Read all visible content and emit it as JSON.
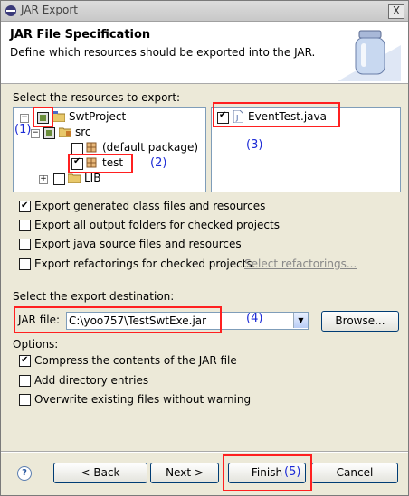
{
  "window": {
    "title": "JAR Export",
    "close_label": "X"
  },
  "header": {
    "title": "JAR File Specification",
    "subtitle": "Define which resources should be exported into the JAR."
  },
  "resources": {
    "label": "Select the resources to export:",
    "tree": {
      "project": "SwtProject",
      "src": "src",
      "default_package": "(default package)",
      "test": "test",
      "lib": "LIB"
    },
    "files": [
      {
        "name": "EventTest.java",
        "checked": true
      }
    ]
  },
  "options_top": [
    {
      "label": "Export generated class files and resources",
      "checked": true
    },
    {
      "label": "Export all output folders for checked projects",
      "checked": false
    },
    {
      "label": "Export java source files and resources",
      "checked": false
    },
    {
      "label": "Export refactorings for checked projects.",
      "checked": false,
      "link": "Select refactorings..."
    }
  ],
  "destination": {
    "label": "Select the export destination:",
    "jar_label": "JAR file:",
    "jar_value": "C:\\yoo757\\TestSwtExe.jar",
    "browse": "Browse..."
  },
  "options": {
    "label": "Options:",
    "items": [
      {
        "label": "Compress the contents of the JAR file",
        "checked": true
      },
      {
        "label": "Add directory entries",
        "checked": false
      },
      {
        "label": "Overwrite existing files without warning",
        "checked": false
      }
    ]
  },
  "annotations": {
    "a1": "(1)",
    "a2": "(2)",
    "a3": "(3)",
    "a4": "(4)",
    "a5": "(5)"
  },
  "buttons": {
    "help": "?",
    "back": "< Back",
    "next": "Next >",
    "finish": "Finish",
    "cancel": "Cancel"
  },
  "colors": {
    "annotation_red": "#ff2020",
    "annotation_blue": "#1c2bd6"
  }
}
